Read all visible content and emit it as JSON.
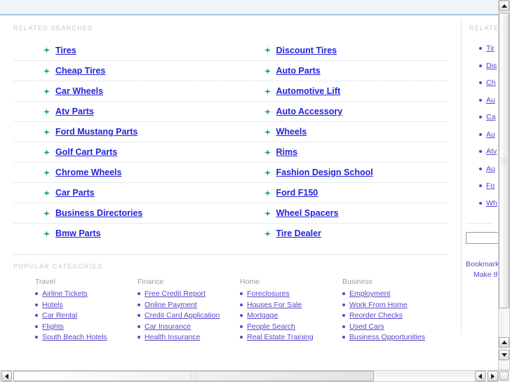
{
  "header": {
    "related_searches_label": "RELATED SEARCHES",
    "popular_categories_label": "POPULAR CATEGORIES"
  },
  "related_searches": {
    "left_column": [
      "Tires",
      "Cheap Tires",
      "Car Wheels",
      "Atv Parts",
      "Ford Mustang Parts",
      "Golf Cart Parts",
      "Chrome Wheels",
      "Car Parts",
      "Business Directories",
      "Bmw Parts"
    ],
    "right_column": [
      "Discount Tires",
      "Auto Parts",
      "Automotive Lift",
      "Auto Accessory",
      "Wheels",
      "Rims",
      "Fashion Design School",
      "Ford F150",
      "Wheel Spacers",
      "Tire Dealer"
    ]
  },
  "popular_categories": [
    {
      "title": "Travel",
      "items": [
        "Airline Tickets",
        "Hotels",
        "Car Rental",
        "Flights",
        "South Beach Hotels"
      ]
    },
    {
      "title": "Finance",
      "items": [
        "Free Credit Report",
        "Online Payment",
        "Credit Card Application",
        "Car Insurance",
        "Health Insurance"
      ]
    },
    {
      "title": "Home",
      "items": [
        "Foreclosures",
        "Houses For Sale",
        "Mortgage",
        "People Search",
        "Real Estate Training"
      ]
    },
    {
      "title": "Business",
      "items": [
        "Employment",
        "Work From Home",
        "Reorder Checks",
        "Used Cars",
        "Business Opportunities"
      ]
    }
  ],
  "side_panel": {
    "label": "RELATED",
    "items": [
      "Tir",
      "Dis",
      "Ch",
      "Au",
      "Ca",
      "Au",
      "Atv",
      "Au",
      "Fo",
      "Wh"
    ],
    "search_value": "",
    "footer_links": [
      "Bookmark",
      "Make this"
    ]
  },
  "colors": {
    "link_blue": "#2323dd",
    "link_purple": "#5a45c8",
    "spark_green": "#149c7c",
    "label_gray": "#c7c7c7",
    "topbar_bg": "#eef4fa",
    "topbar_border": "#a9c7e4",
    "divider": "#d5e3f2"
  },
  "scrollbars": {
    "vertical": {
      "up_arrow": "arrow-up-icon",
      "down_arrow": "arrow-down-icon"
    },
    "horizontal": {
      "left_arrow": "arrow-left-icon",
      "right_arrow": "arrow-right-icon"
    }
  }
}
